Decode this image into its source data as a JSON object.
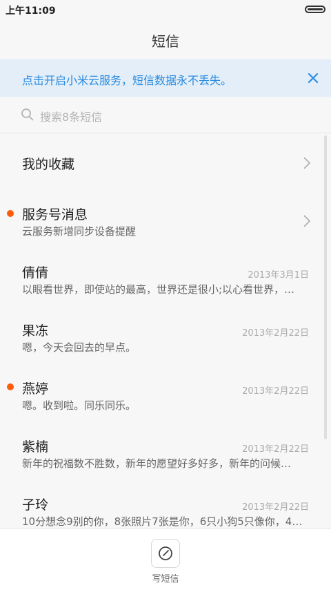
{
  "status": {
    "time": "上午11:09"
  },
  "title": "短信",
  "banner": {
    "text": "点击开启小米云服务，短信数据永不丢失。"
  },
  "search": {
    "placeholder": "搜索8条短信"
  },
  "items": [
    {
      "name": "我的收藏",
      "preview": "",
      "date": "",
      "chevron": true,
      "unread": false
    },
    {
      "name": "服务号消息",
      "preview": "云服务新增同步设备提醒",
      "date": "",
      "chevron": true,
      "unread": true
    },
    {
      "name": "倩倩",
      "preview": "以眼看世界，即使站的最高，世界还是很小;以心看世界，…",
      "date": "2013年3月1日",
      "chevron": false,
      "unread": false
    },
    {
      "name": "果冻",
      "preview": "嗯，今天会回去的早点。",
      "date": "2013年2月22日",
      "chevron": false,
      "unread": false
    },
    {
      "name": "燕婷",
      "preview": "嗯。收到啦。同乐同乐。",
      "date": "2013年2月22日",
      "chevron": false,
      "unread": true
    },
    {
      "name": "紫楠",
      "preview": "新年的祝福数不胜数，新年的愿望好多好多，新年的问候…",
      "date": "2013年2月22日",
      "chevron": false,
      "unread": false
    },
    {
      "name": "子玲",
      "preview": "10分想念9别的你，8张照片7张是你，6只小狗5只像你，4…",
      "date": "2013年2月22日",
      "chevron": false,
      "unread": false
    }
  ],
  "compose": {
    "label": "写短信"
  },
  "colors": {
    "accent": "#2a8be0",
    "unread_dot": "#ff5c0a",
    "banner_bg": "#e3eef8"
  }
}
